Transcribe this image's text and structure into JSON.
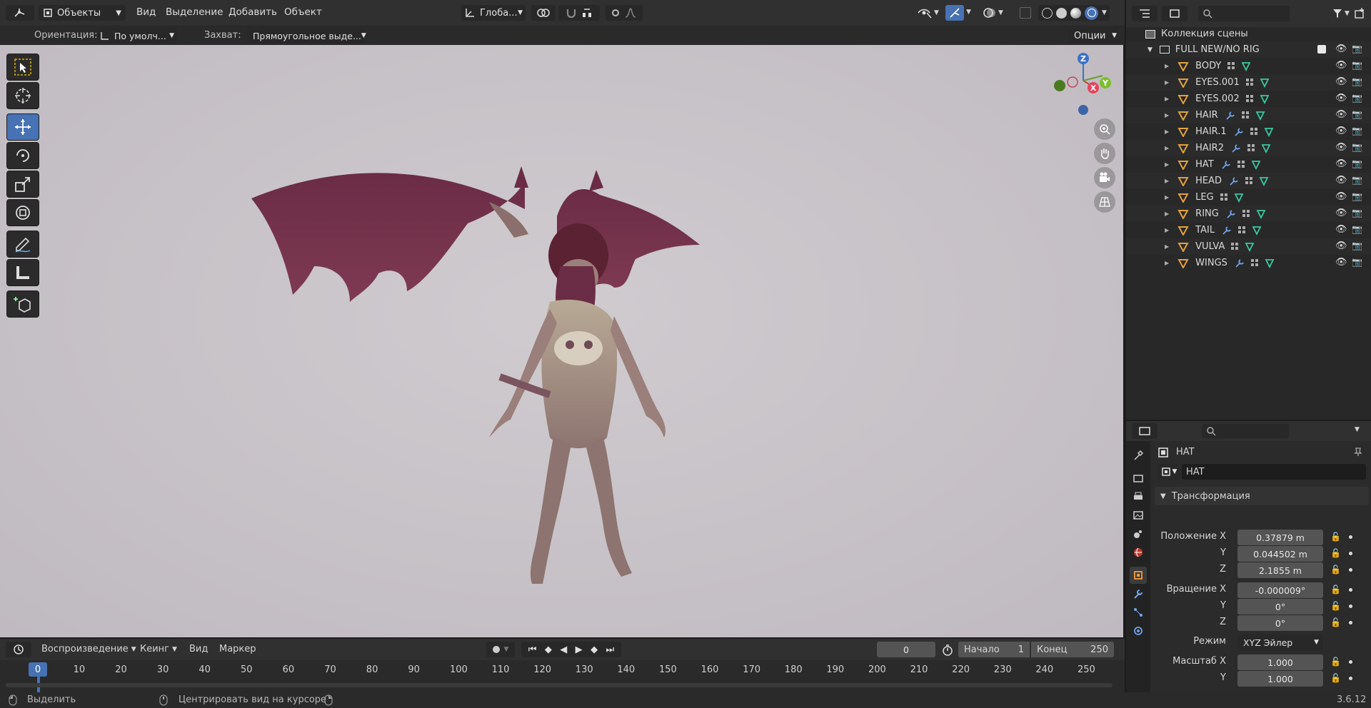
{
  "header": {
    "mode_label": "Объекты",
    "menus": [
      "Вид",
      "Выделение",
      "Добавить",
      "Объект"
    ],
    "transform_orientation": "Глоба..."
  },
  "tool_header": {
    "orientation_label": "Ориентация:",
    "orientation_value": "По умолч...",
    "snap_label": "Захват:",
    "snap_value": "Прямоугольное выде...",
    "options_label": "Опции"
  },
  "gizmo": {
    "z": "Z",
    "x": "X",
    "y": "Y"
  },
  "outliner": {
    "scene_collection": "Коллекция сцены",
    "collection": "FULL NEW/NO RIG",
    "objects": [
      {
        "name": "BODY",
        "modifier": false
      },
      {
        "name": "EYES.001",
        "modifier": false
      },
      {
        "name": "EYES.002",
        "modifier": false
      },
      {
        "name": "HAIR",
        "modifier": true
      },
      {
        "name": "HAIR.1",
        "modifier": true
      },
      {
        "name": "HAIR2",
        "modifier": true
      },
      {
        "name": "HAT",
        "modifier": true
      },
      {
        "name": "HEAD",
        "modifier": true
      },
      {
        "name": "LEG",
        "modifier": false
      },
      {
        "name": "RING",
        "modifier": true
      },
      {
        "name": "TAIL",
        "modifier": true
      },
      {
        "name": "VULVA",
        "modifier": false
      },
      {
        "name": "WINGS",
        "modifier": true
      }
    ]
  },
  "properties": {
    "object_name": "HAT",
    "object_field": "HAT",
    "panel_title": "Трансформация",
    "location_label": "Положение X",
    "location": {
      "x": "0.37879 m",
      "y": "0.044502 m",
      "z": "2.1855 m"
    },
    "rotation_label": "Вращение X",
    "rotation": {
      "x": "-0.000009°",
      "y": "0°",
      "z": "0°"
    },
    "mode_label": "Режим",
    "mode_value": "XYZ Эйлер",
    "scale_label": "Масштаб X",
    "scale": {
      "x": "1.000",
      "y": "1.000"
    },
    "axis_y": "Y",
    "axis_z": "Z"
  },
  "timeline": {
    "menus": [
      "Воспроизведение",
      "Кеинг",
      "Вид",
      "Маркер"
    ],
    "current_frame": "0",
    "start_label": "Начало",
    "start_value": "1",
    "end_label": "Конец",
    "end_value": "250",
    "playhead": "0",
    "ticks": [
      "10",
      "20",
      "30",
      "40",
      "50",
      "60",
      "70",
      "80",
      "90",
      "100",
      "110",
      "120",
      "130",
      "140",
      "150",
      "160",
      "170",
      "180",
      "190",
      "200",
      "210",
      "220",
      "230",
      "240",
      "250"
    ]
  },
  "statusbar": {
    "left_hint": "Выделить",
    "middle_hint": "Центрировать вид на курсоре",
    "version": "3.6.12"
  },
  "colors": {
    "accent": "#4772b3",
    "mesh_icon": "#e0a040",
    "data_icon": "#39c7a0",
    "modifier_icon": "#6fa4e8"
  }
}
